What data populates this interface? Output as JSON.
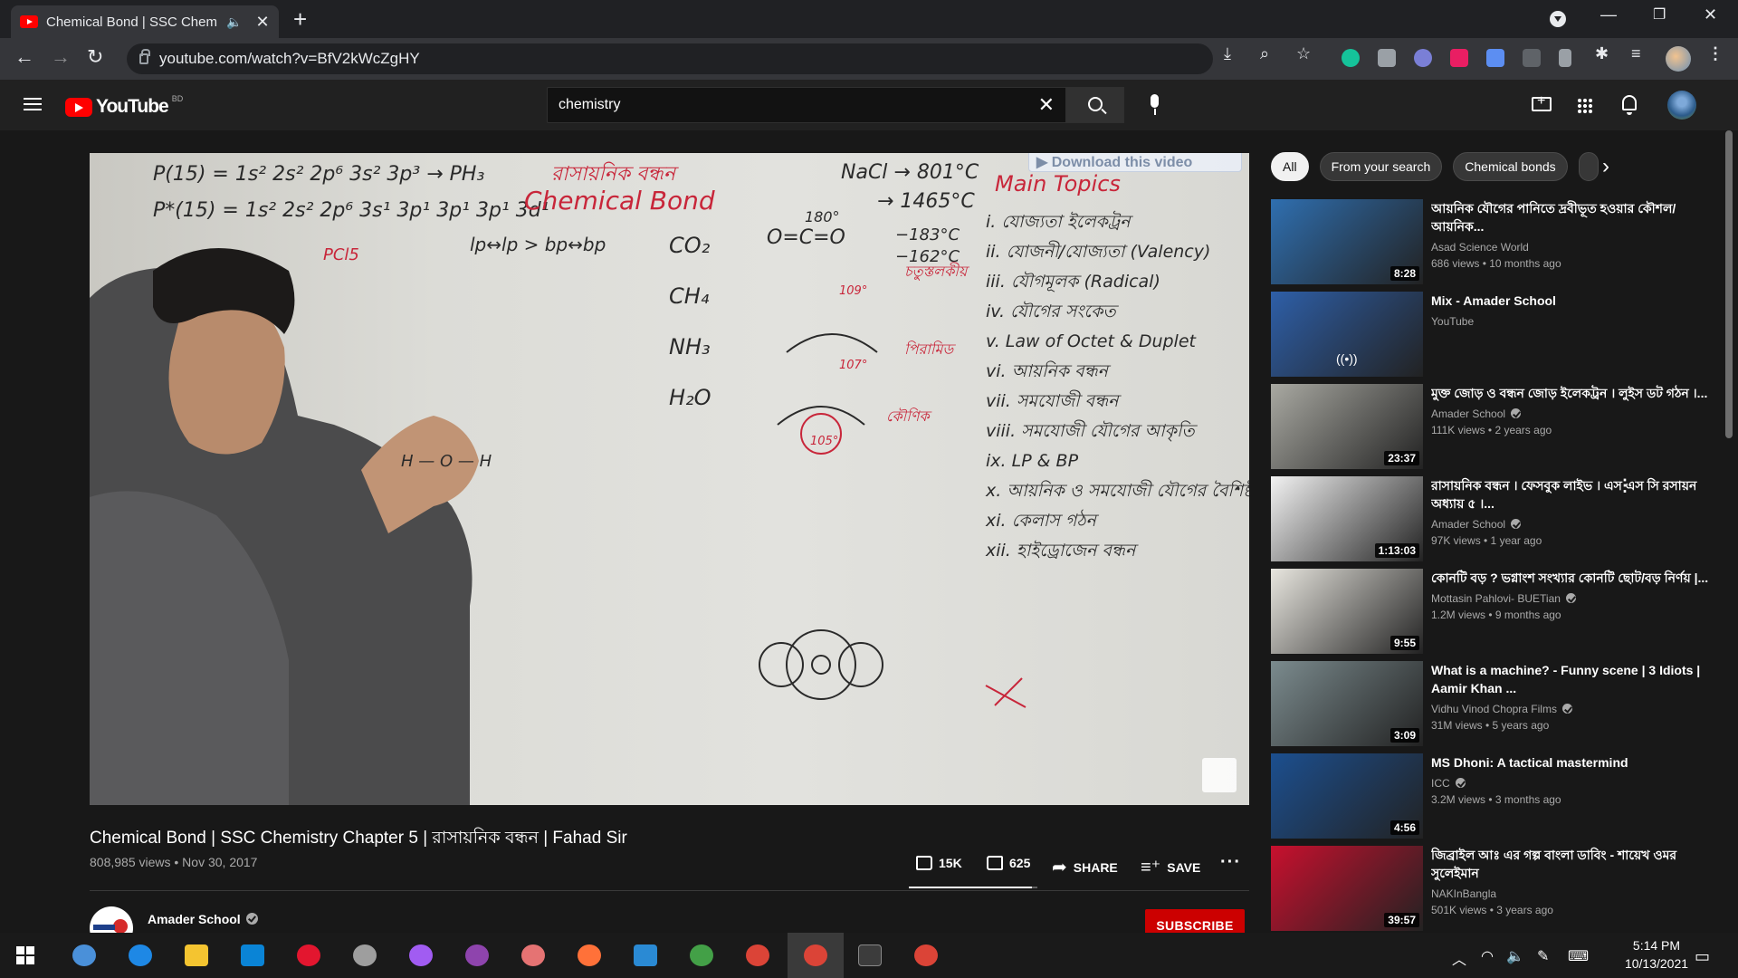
{
  "browser": {
    "tab_title": "Chemical Bond | SSC Chemis",
    "url": "youtube.com/watch?v=BfV2kWcZgHY"
  },
  "youtube": {
    "logo_text": "YouTube",
    "country_code": "BD",
    "search_value": "chemistry"
  },
  "player": {
    "download_overlay": "▶ Download this video",
    "board_text": {
      "line1": "P(15) = 1s² 2s² 2p⁶ 3s² 3p³ → PH₃",
      "line2": "P*(15) = 1s² 2s² 2p⁶ 3s¹ 3p¹ 3p¹ 3p¹ 3d¹",
      "pcl5": "PCl5",
      "title_bn": "রাসায়নিক বন্ধন",
      "title_en": "Chemical Bond",
      "nacl": "NaCl → 801°C",
      "nacl2": "→ 1465°C",
      "temp1": "−183°C",
      "temp2": "−162°C",
      "angle180": "180°",
      "co2_struct": "O=C=O",
      "molecules": [
        "CO₂",
        "CH₄",
        "NH₃",
        "H₂O"
      ],
      "lp_bp": "lp↔lp > bp↔bp",
      "main_topics": "Main Topics",
      "topics": [
        "i. যোজ্যতা ইলেকট্রন",
        "ii. যোজনী/যোজ্যতা (Valency)",
        "iii. যৌগমূলক (Radical)",
        "iv. যৌগের সংকেত",
        "v. Law of Octet & Duplet",
        "vi. আয়নিক বন্ধন",
        "vii. সমযোজী বন্ধন",
        "viii. সমযোজী যৌগের আকৃতি",
        "ix. LP & BP",
        "x. আয়নিক ও সমযোজী যৌগের বৈশিষ্ট্য",
        "xi. কেলাস গঠন",
        "xii. হাইড্রোজেন বন্ধন"
      ],
      "tetrahedral": "চতুস্তলকীয়",
      "pyramidal": "পিরামিড",
      "bent": "কৌণিক",
      "angle1": "109°",
      "angle2": "107°",
      "angle3": "105°",
      "h2o_draw": "H — O — H"
    }
  },
  "video": {
    "title": "Chemical Bond | SSC Chemistry Chapter 5 | রাসায়নিক বন্ধন | Fahad Sir",
    "views_date": "808,985 views • Nov 30, 2017",
    "likes": "15K",
    "dislikes": "625",
    "share_label": "SHARE",
    "save_label": "SAVE",
    "like_ratio": 0.96,
    "channel": "Amader School",
    "subscribe_label": "SUBSCRIBE"
  },
  "chips": [
    "All",
    "From your search",
    "Chemical bonds"
  ],
  "recommendations": [
    {
      "title": "আয়নিক যৌগের পানিতে দ্রবীভূত হওয়ার কৌশল/ আয়নিক...",
      "channel": "Asad Science World",
      "verified": false,
      "meta": "686 views • 10 months ago",
      "duration": "8:28",
      "thumb_color": "#2f6fb0"
    },
    {
      "title": "Mix - Amader School",
      "channel": "YouTube",
      "verified": false,
      "meta": "",
      "duration": "",
      "thumb_color": "#2e5fa8"
    },
    {
      "title": "মুক্ত জোড় ও বন্ধন জোড় ইলেকট্রন । লুইস ডট গঠন ।...",
      "channel": "Amader School",
      "verified": true,
      "meta": "111K views • 2 years ago",
      "duration": "23:37",
      "thumb_color": "#a9a9a2"
    },
    {
      "title": "রাসায়নিক বন্ধন । ফেসবুক লাইভ । এস এস সি রসায়ন অধ্যায় ৫ ।...",
      "channel": "Amader School",
      "verified": true,
      "meta": "97K views • 1 year ago",
      "duration": "1:13:03",
      "thumb_color": "#f2f2f2"
    },
    {
      "title": "কোনটি বড় ? ভগ্নাংশ সংখ্যার কোনটি ছোট/বড় নির্ণয় |...",
      "channel": "Mottasin Pahlovi- BUETian",
      "verified": true,
      "meta": "1.2M views • 9 months ago",
      "duration": "9:55",
      "thumb_color": "#e8e6df"
    },
    {
      "title": "What is a machine? - Funny scene | 3 Idiots | Aamir Khan ...",
      "channel": "Vidhu Vinod Chopra Films",
      "verified": true,
      "meta": "31M views • 5 years ago",
      "duration": "3:09",
      "thumb_color": "#7b8b8e"
    },
    {
      "title": "MS Dhoni: A tactical mastermind",
      "channel": "ICC",
      "verified": true,
      "meta": "3.2M views • 3 months ago",
      "duration": "4:56",
      "thumb_color": "#1c4f8f"
    },
    {
      "title": "জিব্রাইল আঃ এর গল্প বাংলা ডাবিং - শায়েখ ওমর সুলেইমান",
      "channel": "NAKInBangla",
      "verified": false,
      "meta": "501K views • 3 years ago",
      "duration": "39:57",
      "thumb_color": "#c8102e"
    }
  ],
  "taskbar": {
    "time": "5:14 PM",
    "date": "10/13/2021"
  },
  "icons": {
    "back": "arrow-left-icon",
    "forward": "arrow-right-icon",
    "reload": "reload-icon",
    "menu": "hamburger-icon",
    "search": "search-icon",
    "mic": "microphone-icon",
    "create": "create-video-icon",
    "apps": "apps-grid-icon",
    "notifications": "bell-icon"
  }
}
